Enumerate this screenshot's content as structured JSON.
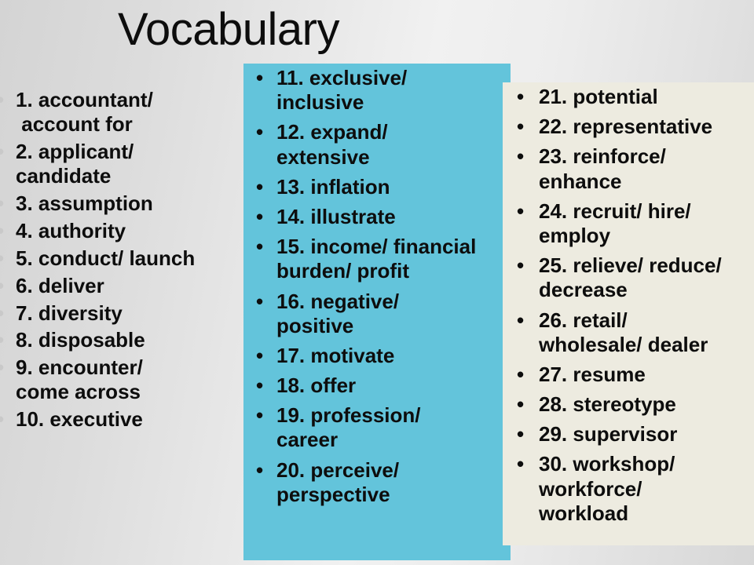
{
  "slide": {
    "title": "Vocabulary",
    "bullet_glyph": "•",
    "colors": {
      "panel_blue": "#63c4db",
      "panel_cream": "#edebe0",
      "text": "#0d0d0d",
      "background_light": "#f1f1f1",
      "background_dark": "#d4d4d4",
      "faint_bullet": "#c9c9c9"
    }
  },
  "columns": [
    {
      "name": "column-one",
      "items": [
        "1. accountant/\n account for",
        "2. applicant/\ncandidate",
        "3. assumption",
        "4. authority",
        "5. conduct/ launch",
        "6. deliver",
        "7. diversity",
        "8. disposable",
        "9. encounter/\ncome across",
        "10. executive"
      ]
    },
    {
      "name": "column-two",
      "items": [
        "11. exclusive/\ninclusive",
        "12. expand/\nextensive",
        "13. inflation",
        "14. illustrate",
        "15. income/ financial\nburden/ profit",
        "16. negative/\npositive",
        "17. motivate",
        "18. offer",
        "19. profession/\ncareer",
        "20. perceive/\nperspective"
      ]
    },
    {
      "name": "column-three",
      "items": [
        "21. potential",
        "22. representative",
        "23. reinforce/\nenhance",
        "24. recruit/ hire/\nemploy",
        "25. relieve/ reduce/\ndecrease",
        "26. retail/\nwholesale/ dealer",
        "27. resume",
        "28. stereotype",
        "29. supervisor",
        "30. workshop/\nworkforce/\nworkload"
      ]
    }
  ]
}
